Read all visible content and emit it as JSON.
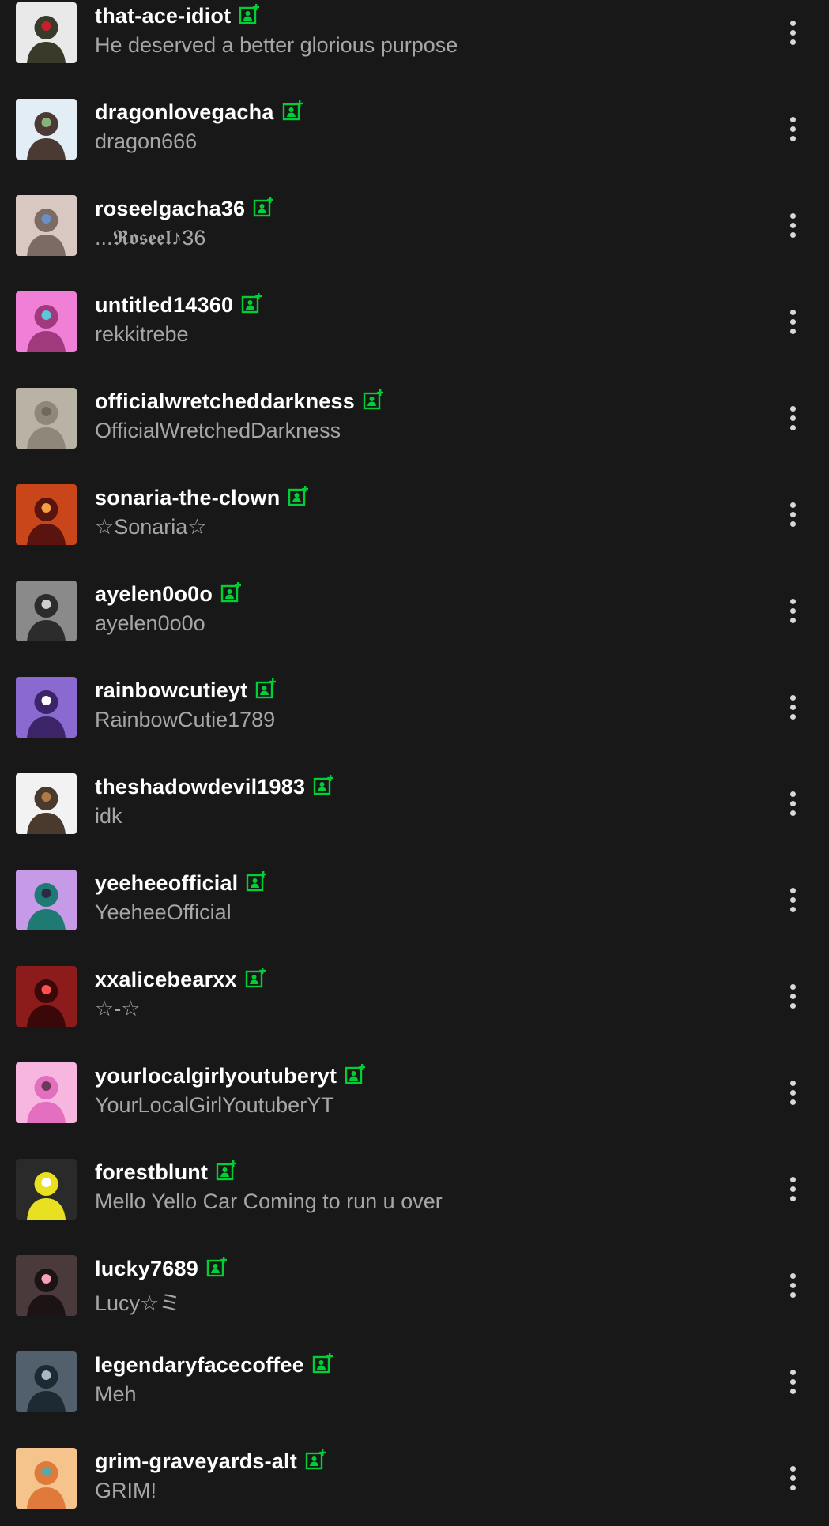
{
  "colors": {
    "background": "#181818",
    "username": "#ffffff",
    "subtitle": "#a6a6a6",
    "follow_icon": "#00cf35",
    "menu_dots": "#d8d8d8"
  },
  "icons": {
    "follow": "person-plus-icon",
    "menu": "more-vertical-icon"
  },
  "users": [
    {
      "username": "that-ace-idiot",
      "title": "He deserved a better glorious purpose",
      "avatar_bg": "#e9e9e9",
      "avatar_fg": "#3a3a2a",
      "avatar_accent": "#c8202a"
    },
    {
      "username": "dragonlovegacha",
      "title": "dragon666",
      "avatar_bg": "#e3edf6",
      "avatar_fg": "#4b3a33",
      "avatar_accent": "#88b27a"
    },
    {
      "username": "roseelgacha36",
      "title": "...𝕽𝖔𝖘𝖊𝖊𝖑♪36",
      "avatar_bg": "#d9c7c2",
      "avatar_fg": "#7c6a64",
      "avatar_accent": "#6b8fc4"
    },
    {
      "username": "untitled14360",
      "title": "rekkitrebe",
      "avatar_bg": "#f07fd8",
      "avatar_fg": "#a13a7c",
      "avatar_accent": "#5ac8d8"
    },
    {
      "username": "officialwretcheddarkness",
      "title": "OfficialWretchedDarkness",
      "avatar_bg": "#b9b3a6",
      "avatar_fg": "#8f877a",
      "avatar_accent": "#6f685e"
    },
    {
      "username": "sonaria-the-clown",
      "title": "☆Sonaria☆",
      "avatar_bg": "#c8461a",
      "avatar_fg": "#5a1410",
      "avatar_accent": "#f0a040"
    },
    {
      "username": "ayelen0o0o",
      "title": "ayelen0o0o",
      "avatar_bg": "#8a8a8a",
      "avatar_fg": "#2c2c2c",
      "avatar_accent": "#cfcfcf"
    },
    {
      "username": "rainbowcutieyt",
      "title": "RainbowCutie1789",
      "avatar_bg": "#8a6ad0",
      "avatar_fg": "#3c2468",
      "avatar_accent": "#ffffff"
    },
    {
      "username": "theshadowdevil1983",
      "title": "idk",
      "avatar_bg": "#f2f2f2",
      "avatar_fg": "#4a3a2e",
      "avatar_accent": "#b07a48"
    },
    {
      "username": "yeeheeofficial",
      "title": "YeeheeOfficial",
      "avatar_bg": "#c79ae8",
      "avatar_fg": "#1f7a74",
      "avatar_accent": "#2c2a46"
    },
    {
      "username": "xxalicebearxx",
      "title": "☆-☆",
      "avatar_bg": "#8c1c1c",
      "avatar_fg": "#3a0808",
      "avatar_accent": "#ff5050"
    },
    {
      "username": "yourlocalgirlyoutuberyt",
      "title": "YourLocalGirlYoutuberYT",
      "avatar_bg": "#f6b6e0",
      "avatar_fg": "#e46ec0",
      "avatar_accent": "#6a3a58"
    },
    {
      "username": "forestblunt",
      "title": "Mello Yello Car Coming to run u over",
      "avatar_bg": "#2a2a2a",
      "avatar_fg": "#e8e020",
      "avatar_accent": "#ffffff"
    },
    {
      "username": "lucky7689",
      "title": "Lucy☆ミ",
      "avatar_bg": "#4a3a3c",
      "avatar_fg": "#1c1414",
      "avatar_accent": "#f4a0b8"
    },
    {
      "username": "legendaryfacecoffee",
      "title": "Meh",
      "avatar_bg": "#51606c",
      "avatar_fg": "#1e2a32",
      "avatar_accent": "#a8b8c4"
    },
    {
      "username": "grim-graveyards-alt",
      "title": "GRIM!",
      "avatar_bg": "#f4c48c",
      "avatar_fg": "#e07a3c",
      "avatar_accent": "#5aa8a0"
    }
  ]
}
